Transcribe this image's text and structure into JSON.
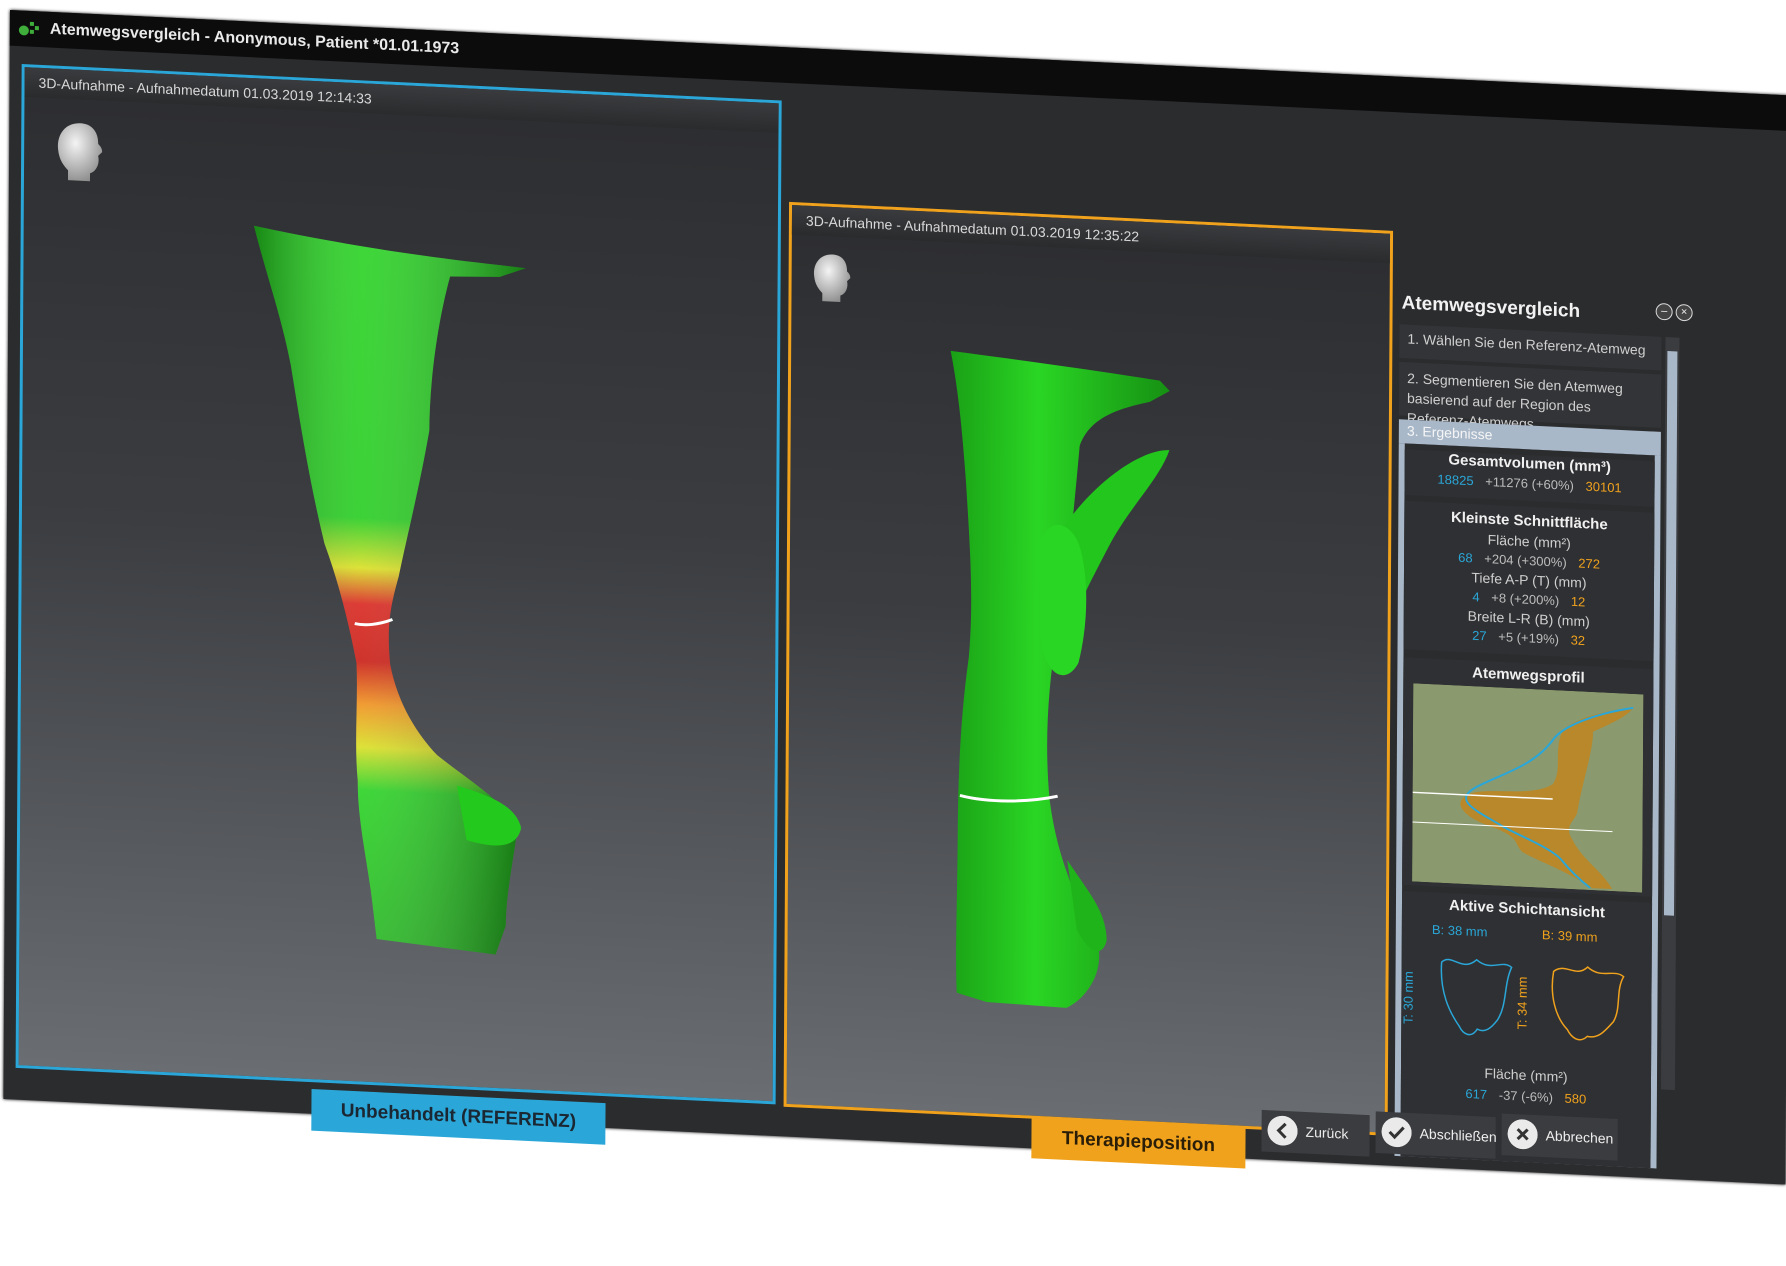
{
  "window": {
    "title": "Atemwegsvergleich - Anonymous, Patient *01.01.1973"
  },
  "viewports": {
    "left": {
      "header": "3D-Aufnahme - Aufnahmedatum 01.03.2019 12:14:33",
      "tab_label": "Unbehandelt (REFERENZ)",
      "border_color": "#2aa7d8"
    },
    "right": {
      "header": "3D-Aufnahme - Aufnahmedatum 01.03.2019 12:35:22",
      "tab_label": "Therapieposition",
      "border_color": "#f0a21d"
    }
  },
  "panel": {
    "title": "Atemwegsvergleich",
    "steps": [
      "1. Wählen Sie den Referenz-Atemweg",
      "2. Segmentieren Sie den Atemweg basierend auf der Region des Referenz-Atemwegs",
      "3. Ergebnisse"
    ],
    "total_volume": {
      "title": "Gesamtvolumen (mm³)",
      "ref": "18825",
      "diff": "+11276 (+60%)",
      "ther": "30101"
    },
    "smallest_cross_section": {
      "title": "Kleinste Schnittfläche",
      "metrics": [
        {
          "label": "Fläche (mm²)",
          "ref": "68",
          "diff": "+204 (+300%)",
          "ther": "272"
        },
        {
          "label": "Tiefe A-P (T) (mm)",
          "ref": "4",
          "diff": "+8 (+200%)",
          "ther": "12"
        },
        {
          "label": "Breite L-R (B) (mm)",
          "ref": "27",
          "diff": "+5 (+19%)",
          "ther": "32"
        }
      ]
    },
    "profile": {
      "title": "Atemwegsprofil"
    },
    "active_slice": {
      "title": "Aktive Schichtansicht",
      "ref_width": "B: 38 mm",
      "ref_depth": "T: 30 mm",
      "ther_width": "B: 39 mm",
      "ther_depth": "T: 34 mm",
      "area_label": "Fläche (mm²)",
      "ref": "617",
      "diff": "-37 (-6%)",
      "ther": "580"
    }
  },
  "buttons": {
    "back": "Zurück",
    "finish": "Abschließen",
    "cancel": "Abbrechen"
  },
  "colors": {
    "reference": "#2aa7d8",
    "therapy": "#f0a21d",
    "airway": "#22d11d",
    "constriction": "#d01a10"
  }
}
